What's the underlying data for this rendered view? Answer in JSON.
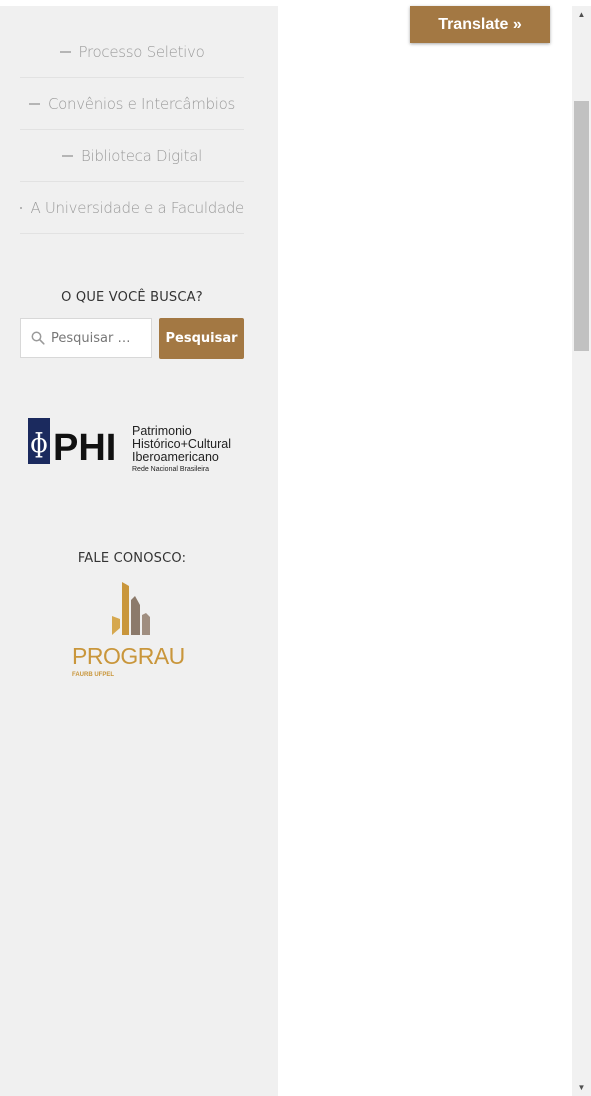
{
  "menu": {
    "items": [
      {
        "label": "Processo Seletivo"
      },
      {
        "label": "Convênios e Intercâmbios"
      },
      {
        "label": "Biblioteca Digital"
      },
      {
        "label": "A Universidade e a Faculdade"
      }
    ]
  },
  "search": {
    "title": "O QUE VOCÊ BUSCA?",
    "placeholder": "Pesquisar …",
    "button_label": "Pesquisar"
  },
  "phi_logo": {
    "mark": "PHI",
    "line1": "Patrimonio",
    "line2": "Histórico+Cultural",
    "line3": "Iberoamericano",
    "line4": "Rede Nacional Brasileira"
  },
  "contact": {
    "title": "FALE CONOSCO:"
  },
  "prograu_logo": {
    "name": "PROGRAU",
    "sub": "FAURB UFPEL"
  },
  "translate": {
    "label": "Translate »"
  },
  "colors": {
    "accent": "#a37843",
    "sidebar_bg": "#f0f0f0",
    "phi_blue": "#1b2a5e",
    "prograu_gold": "#c9963b"
  }
}
